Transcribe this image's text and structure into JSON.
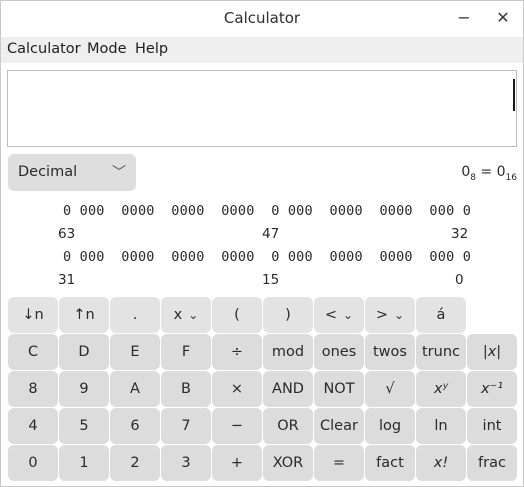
{
  "window": {
    "title": "Calculator",
    "minimize_glyph": "−",
    "close_glyph": "✕"
  },
  "menu": [
    "Calculator",
    "Mode",
    "Help"
  ],
  "display": {
    "value": ""
  },
  "mode": {
    "selected": "Decimal",
    "chevron_icon": "chevron-down-icon",
    "chevron_glyph": "⌵"
  },
  "base_info": {
    "oct": "0",
    "oct_base": "8",
    "eq": " = ",
    "hex": "0",
    "hex_base": "16"
  },
  "bits": {
    "row1": "0 000  0000  0000  0000  0 000  0000  0000  000 0",
    "row1_labels": [
      "63",
      "47",
      "32"
    ],
    "row2": "0 000  0000  0000  0000  0 000  0000  0000  000 0",
    "row2_labels": [
      "31",
      "15",
      "0"
    ]
  },
  "keys": {
    "row0": [
      "↓n",
      "↑n",
      ".",
      "x",
      "(",
      ")",
      "<",
      ">",
      "á"
    ],
    "row1": [
      "C",
      "D",
      "E",
      "F",
      "÷",
      "mod",
      "ones",
      "twos",
      "trunc",
      "|x|"
    ],
    "row2": [
      "8",
      "9",
      "A",
      "B",
      "×",
      "AND",
      "NOT",
      "√",
      "xʸ",
      "x⁻¹"
    ],
    "row3": [
      "4",
      "5",
      "6",
      "7",
      "−",
      "OR",
      "Clear",
      "log",
      "ln",
      "int"
    ],
    "row4": [
      "0",
      "1",
      "2",
      "3",
      "+",
      "XOR",
      "=",
      "fact",
      "x!",
      "frac"
    ]
  },
  "colors": {
    "key_bg": "#dcdcdc",
    "menubar_bg": "#efefef"
  }
}
